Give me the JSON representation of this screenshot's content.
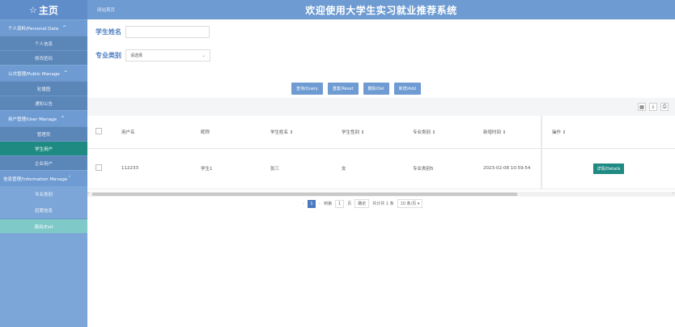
{
  "sidebar": {
    "home_label": "主页",
    "groups": [
      {
        "label": "个人资料/Personal Data",
        "chevron": "^"
      },
      {
        "label": "公共管理/Public Manage",
        "chevron": "^"
      },
      {
        "label": "用户管理/User Manage",
        "chevron": "^"
      },
      {
        "label": "信息管理/Information Manage",
        "chevron": "˅"
      }
    ],
    "items": [
      {
        "label": "个人信息"
      },
      {
        "label": "修改密码"
      },
      {
        "label": "轮播图"
      },
      {
        "label": "通知公告"
      },
      {
        "label": "管理员"
      },
      {
        "label": "学生用户"
      },
      {
        "label": "企业用户"
      },
      {
        "label": "专业类别"
      },
      {
        "label": "招聘信息"
      },
      {
        "label": "退出/Exit"
      }
    ]
  },
  "header": {
    "breadcrumb": "网站首页",
    "title": "欢迎使用大学生实习就业推荐系统"
  },
  "filters": {
    "name_label": "学生姓名",
    "name_value": "",
    "category_label": "专业类别",
    "category_selected": "请选择"
  },
  "buttons": {
    "query": "查询/Query",
    "reset": "重置/Reset",
    "delete": "删除/Del",
    "add": "新增/Add"
  },
  "table": {
    "columns": [
      "用户名",
      "昵称",
      "学生姓名 ⇕",
      "学生性别 ⇕",
      "专业类别 ⇕",
      "新增时间 ⇕",
      "操作 ⇕"
    ],
    "rows": [
      {
        "username": "112233",
        "nickname": "学生1",
        "name": "张三",
        "gender": "女",
        "category": "专业类别5",
        "created": "2023-02-08 10:59:54",
        "action": "详情/Details"
      }
    ]
  },
  "pagination": {
    "current_page": "1",
    "goto_label": "到第",
    "goto_value": "1",
    "page_unit": "页",
    "confirm": "确定",
    "total": "共计共 1 条",
    "page_size": "10 条/页 ▾"
  }
}
